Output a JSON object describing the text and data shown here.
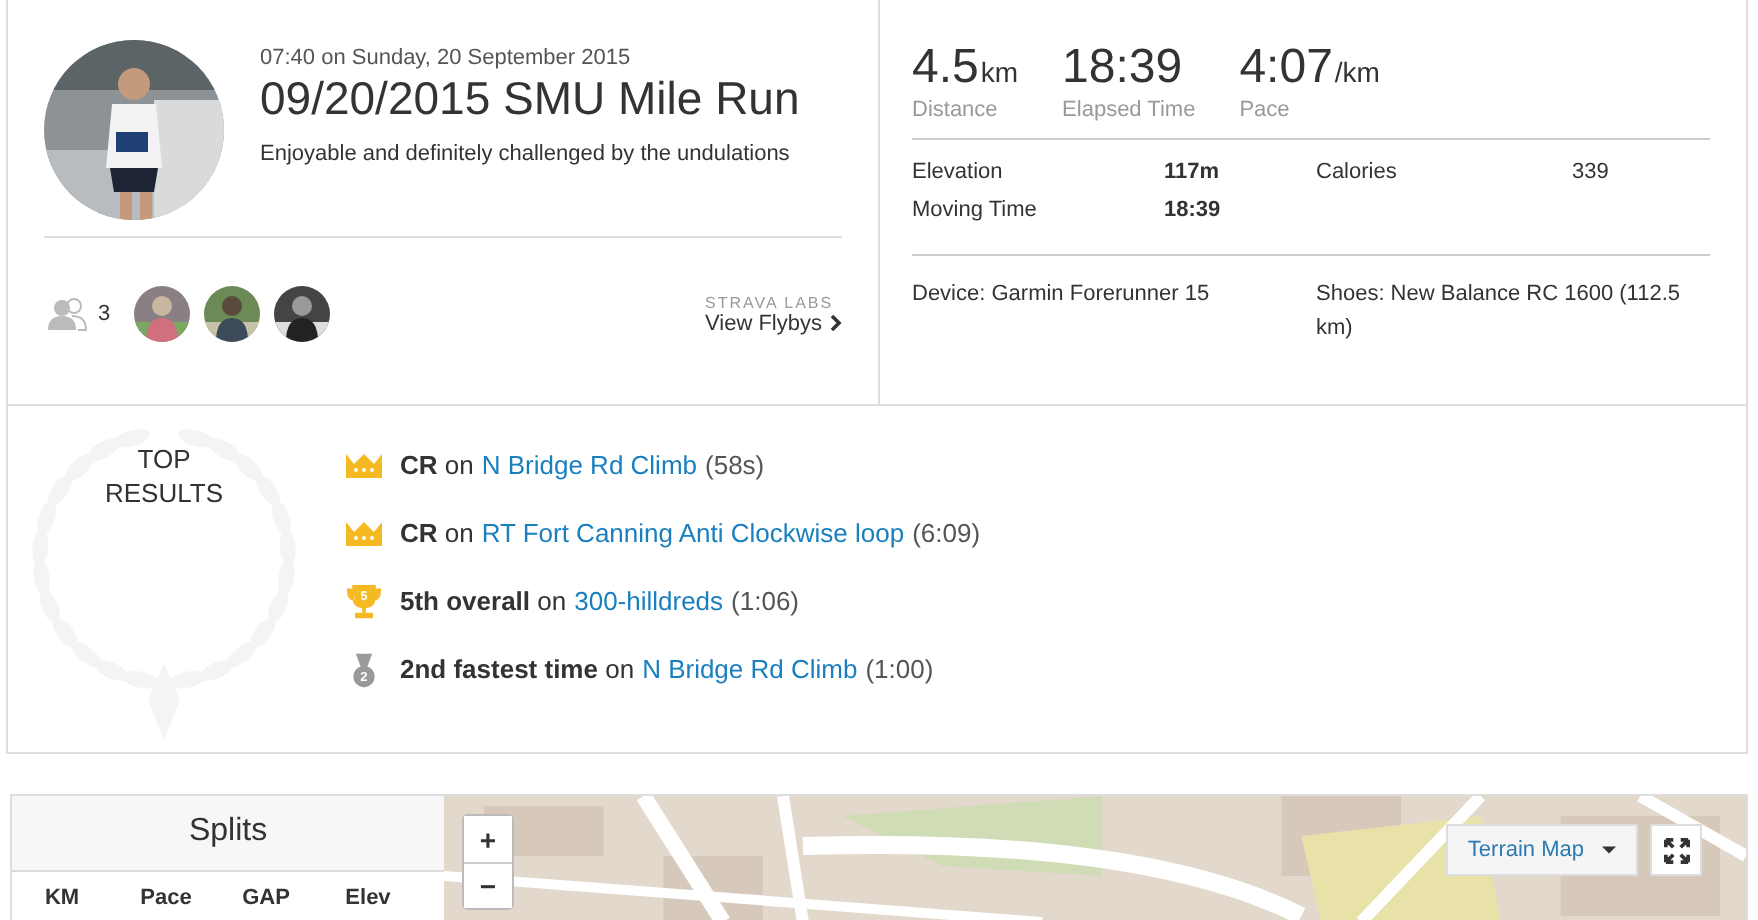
{
  "activity": {
    "datetime": "07:40 on Sunday, 20 September 2015",
    "title": "09/20/2015 SMU Mile Run",
    "description": "Enjoyable and definitely challenged by the undulations"
  },
  "kudos": {
    "count": "3"
  },
  "flybys": {
    "label": "STRAVA LABS",
    "link": "View Flybys"
  },
  "stats": [
    {
      "value": "4.5",
      "unit": "km",
      "label": "Distance"
    },
    {
      "value": "18:39",
      "label": "Elapsed Time"
    },
    {
      "value": "4:07",
      "unit": "/km",
      "label": "Pace"
    }
  ],
  "details": [
    {
      "label": "Elevation",
      "value": "117m",
      "bold": true
    },
    {
      "label": "Calories",
      "value": "339",
      "bold": false
    },
    {
      "label": "Moving Time",
      "value": "18:39",
      "bold": true
    }
  ],
  "device": "Device: Garmin Forerunner 15",
  "shoes": "Shoes: New Balance RC 1600 (112.5 km)",
  "top_results": {
    "title": "TOP RESULTS",
    "rows": [
      {
        "kind": "crown",
        "achievement": "**CR** on",
        "segment": "N Bridge Rd Climb",
        "time": "(58s)"
      },
      {
        "kind": "crown",
        "achievement": "**CR** on",
        "segment": "RT Fort Canning Anti Clockwise loop",
        "time": "(6:09)"
      },
      {
        "kind": "trophy",
        "badge": "5",
        "achievement": "**5th overall** on",
        "segment": "300-hilldreds",
        "time": "(1:06)"
      },
      {
        "kind": "medal",
        "badge": "2",
        "achievement": "**2nd fastest time** on",
        "segment": "N Bridge Rd Climb",
        "time": "(1:00)"
      }
    ]
  },
  "splits": {
    "title": "Splits",
    "columns": [
      "KM",
      "Pace",
      "GAP",
      "Elev"
    ]
  },
  "map": {
    "zoom_in": "+",
    "zoom_out": "−",
    "map_type": "Terrain Map"
  }
}
